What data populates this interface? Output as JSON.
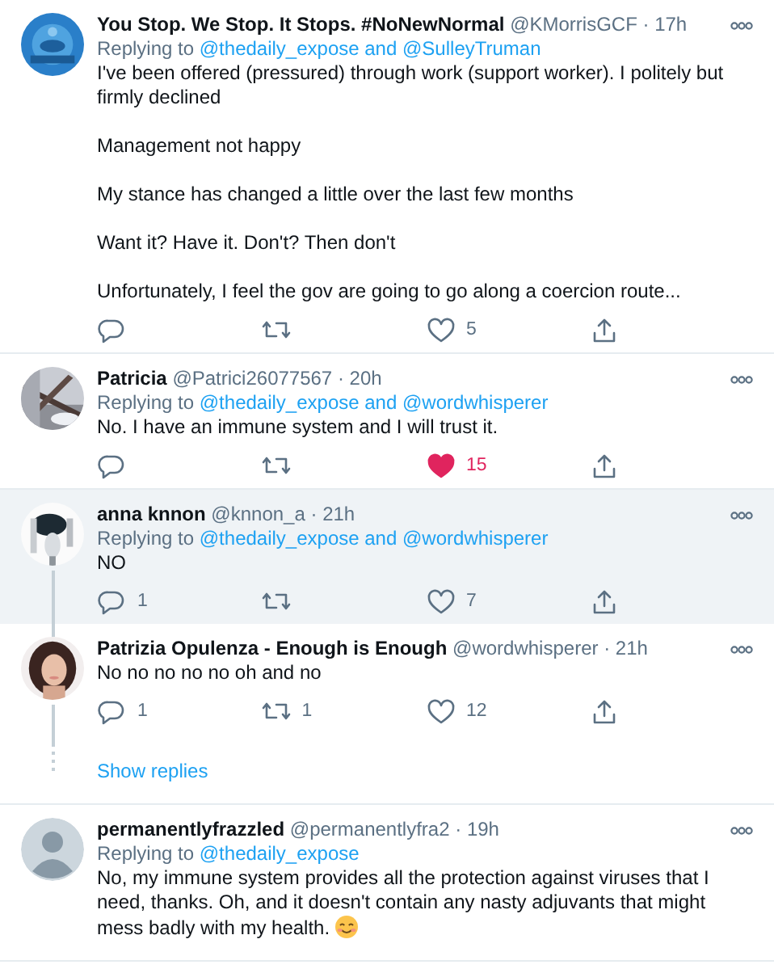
{
  "threads": [
    {
      "tweets": [
        {
          "avatar": {
            "kind": "picture"
          },
          "name": "You Stop. We Stop. It Stops. #NoNewNormal",
          "handle": "@KMorrisGCF",
          "separator": "·",
          "time": "17h",
          "replying_label": "Replying to",
          "mentions": [
            "@thedaily_expose",
            "@SulleyTruman"
          ],
          "joiner": "and",
          "body": [
            "I've been offered (pressured) through work (support worker). I politely but firmly declined",
            "Management not happy",
            "My stance has changed a little over the last few months",
            "Want it? Have it. Don't? Then don't",
            "Unfortunately, I feel the gov are going to go along a coercion route..."
          ],
          "highlighted": false,
          "thread_below": false,
          "likes": "5",
          "liked": false,
          "smiley": false
        }
      ]
    },
    {
      "tweets": [
        {
          "avatar": {
            "kind": "picture"
          },
          "name": "Patricia",
          "handle": "@Patrici26077567",
          "separator": "·",
          "time": "20h",
          "replying_label": "Replying to",
          "mentions": [
            "@thedaily_expose",
            "@wordwhisperer"
          ],
          "joiner": "and",
          "body": [
            "No. I have an immune system and I will trust it."
          ],
          "highlighted": false,
          "thread_below": false,
          "likes": "15",
          "liked": true,
          "smiley": false
        }
      ]
    },
    {
      "tweets": [
        {
          "avatar": {
            "kind": "picture"
          },
          "name": "anna knnon",
          "handle": "@knnon_a",
          "separator": "·",
          "time": "21h",
          "replying_label": "Replying to",
          "mentions": [
            "@thedaily_expose",
            "@wordwhisperer"
          ],
          "joiner": "and",
          "body": [
            "NO"
          ],
          "highlighted": true,
          "thread_below": true,
          "replies": "1",
          "likes": "7",
          "liked": false,
          "smiley": false
        },
        {
          "avatar": {
            "kind": "picture"
          },
          "name": "Patrizia Opulenza - Enough is Enough",
          "handle": "@wordwhisperer",
          "separator": "·",
          "time": "21h",
          "body": [
            "No no no no no oh and no"
          ],
          "highlighted": false,
          "thread_below": true,
          "replies": "1",
          "retweets": "1",
          "likes": "12",
          "liked": false,
          "smiley": false
        }
      ],
      "show_replies": "Show replies"
    },
    {
      "tweets": [
        {
          "avatar": {
            "kind": "default"
          },
          "name": "permanentlyfrazzled",
          "handle": "@permanentlyfra2",
          "separator": "·",
          "time": "19h",
          "replying_label": "Replying to",
          "mentions": [
            "@thedaily_expose"
          ],
          "body": [
            "No, my immune system provides all the protection against viruses that I need, thanks. Oh, and it doesn't contain any nasty adjuvants that might mess badly with my health."
          ],
          "highlighted": false,
          "thread_below": false,
          "smiley": true
        }
      ]
    }
  ]
}
